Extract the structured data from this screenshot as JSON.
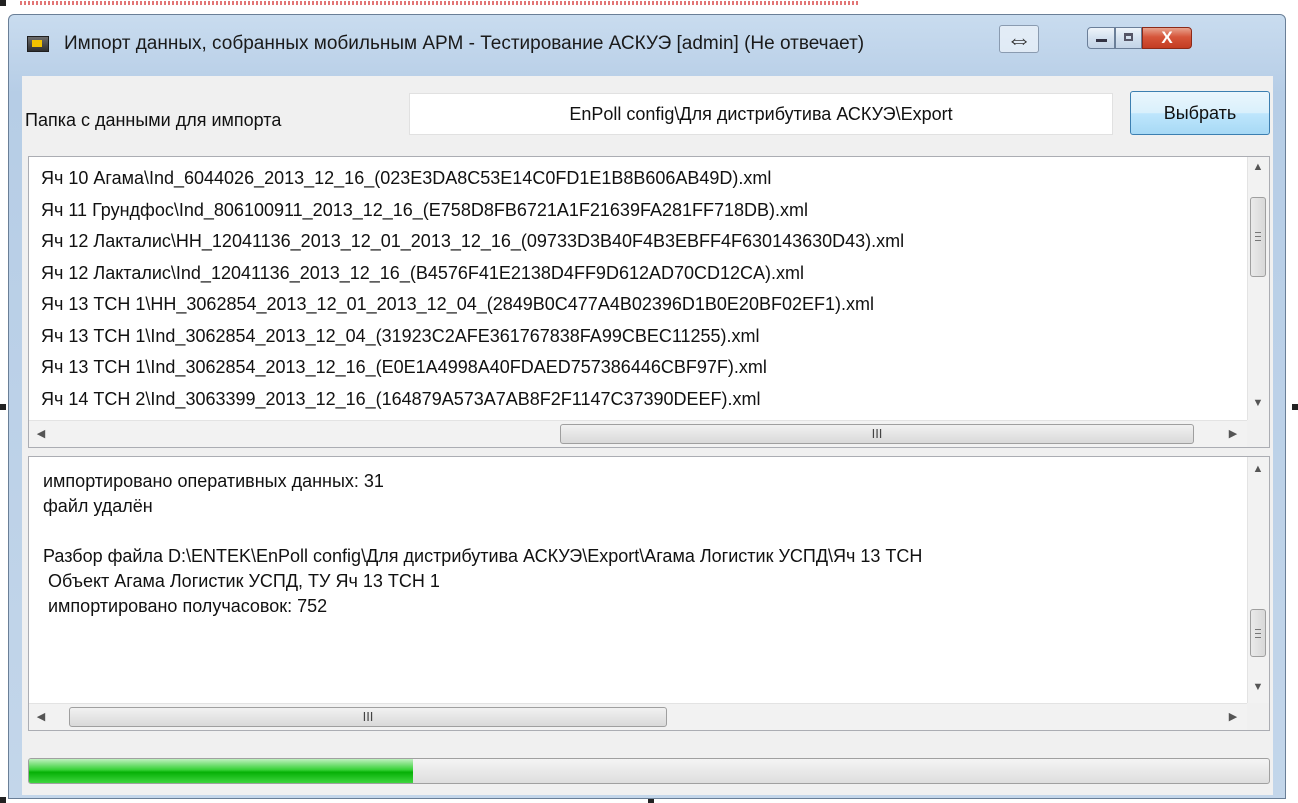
{
  "window": {
    "title": "Импорт данных, собранных мобильным АРМ - Тестирование АСКУЭ [admin] (Не отвечает)",
    "resize_icon": "⇔",
    "close_label": "X"
  },
  "folder": {
    "label": "Папка с данными для импорта",
    "value": "EnPoll config\\Для дистрибутива АСКУЭ\\Export",
    "select_button": "Выбрать"
  },
  "file_list": {
    "items": [
      "Яч 10 Агама\\Ind_6044026_2013_12_16_(023E3DA8C53E14C0FD1E1B8B606AB49D).xml",
      "Яч 11 Грундфос\\Ind_806100911_2013_12_16_(E758D8FB6721A1F21639FA281FF718DB).xml",
      "Яч 12 Лакталис\\HH_12041136_2013_12_01_2013_12_16_(09733D3B40F4B3EBFF4F630143630D43).xml",
      "Яч 12 Лакталис\\Ind_12041136_2013_12_16_(B4576F41E2138D4FF9D612AD70CD12CA).xml",
      "Яч 13 ТСН 1\\HH_3062854_2013_12_01_2013_12_04_(2849B0C477A4B02396D1B0E20BF02EF1).xml",
      "Яч 13 ТСН 1\\Ind_3062854_2013_12_04_(31923C2AFE361767838FA99CBEC11255).xml",
      "Яч 13 ТСН 1\\Ind_3062854_2013_12_16_(E0E1A4998A40FDAED757386446CBF97F).xml",
      "Яч 14 ТСН 2\\Ind_3063399_2013_12_16_(164879A573A7AB8F2F1147C37390DEEF).xml"
    ]
  },
  "log": {
    "lines": [
      "импортировано оперативных данных: 31",
      "файл удалён",
      "",
      "Разбор файла D:\\ENTEK\\EnPoll config\\Для дистрибутива АСКУЭ\\Export\\Агама Логистик УСПД\\Яч 13 ТСН",
      " Объект Агама Логистик УСПД, ТУ Яч 13 ТСН 1",
      " импортировано получасовок: 752"
    ]
  },
  "scroll": {
    "grip": "III"
  },
  "progress": {
    "fraction": 0.31,
    "color": "#06b006"
  }
}
